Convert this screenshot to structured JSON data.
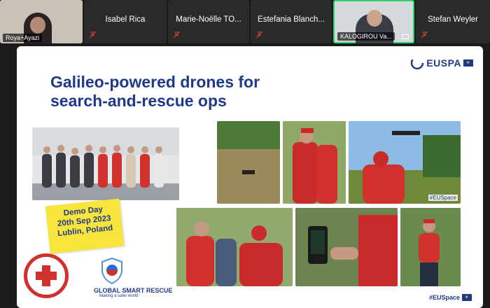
{
  "participants": [
    {
      "name": "Roya+Ayazi",
      "has_video": true
    },
    {
      "name": "Isabel Rica",
      "has_video": false
    },
    {
      "name": "Marie-Noëlle TO...",
      "has_video": false
    },
    {
      "name": "Estefania Blanch...",
      "has_video": false
    },
    {
      "name": "KALOGIROU Va...",
      "has_video": true,
      "active": true
    },
    {
      "name": "Stefan Weyler",
      "has_video": false
    }
  ],
  "slide": {
    "title_line1": "Galileo-powered drones for",
    "title_line2": "search-and-rescue ops",
    "demo_line1": "Demo Day",
    "demo_line2": "20th Sep 2023",
    "demo_line3": "Lublin, Poland",
    "logo_text": "EUSPA",
    "gsr_name": "GLOBAL SMART RESCUE",
    "gsr_tagline": "Making a safer world",
    "hashtag": "#EUSpace",
    "accent_color": "#1f3a8a",
    "highlight_color": "#f7e53b"
  }
}
